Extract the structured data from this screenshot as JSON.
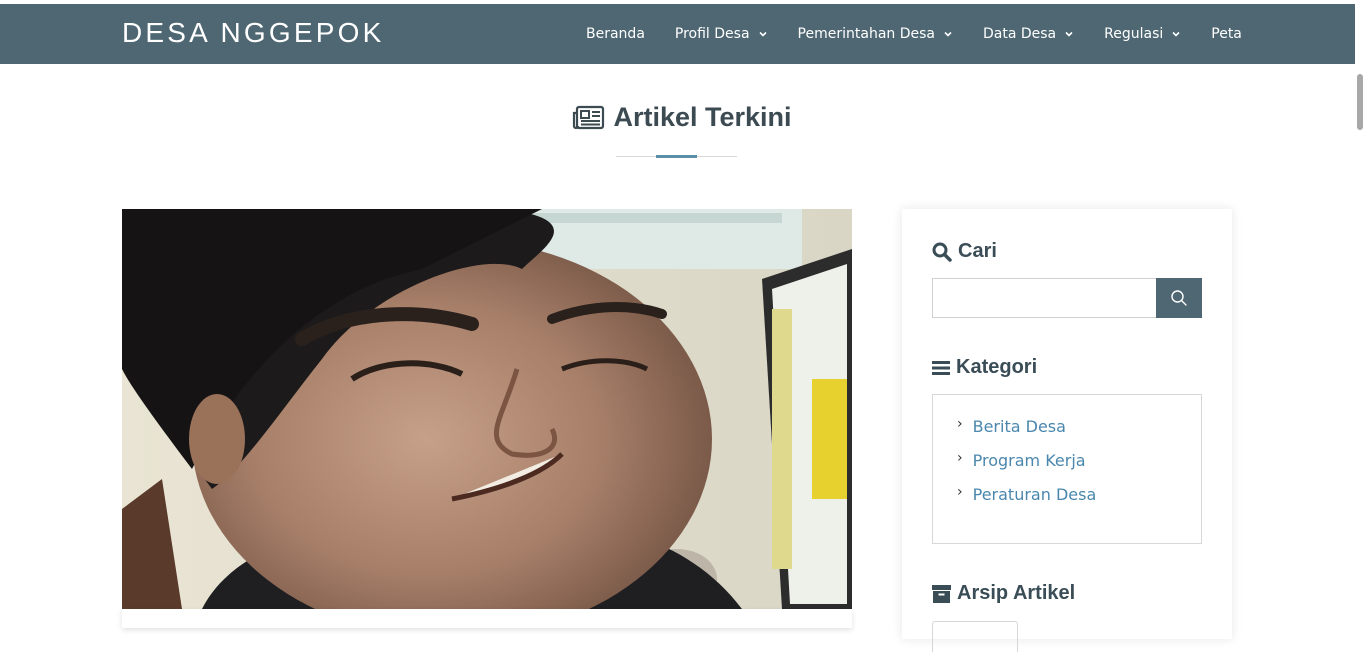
{
  "site": {
    "brand": "DESA NGGEPOK"
  },
  "nav": {
    "items": [
      {
        "label": "Beranda",
        "dropdown": false
      },
      {
        "label": "Profil Desa",
        "dropdown": true
      },
      {
        "label": "Pemerintahan Desa",
        "dropdown": true
      },
      {
        "label": "Data Desa",
        "dropdown": true
      },
      {
        "label": "Regulasi",
        "dropdown": true
      },
      {
        "label": "Peta",
        "dropdown": false
      }
    ]
  },
  "main": {
    "section_title": "Artikel Terkini",
    "section_icon": "newspaper-icon"
  },
  "sidebar": {
    "search": {
      "title": "Cari",
      "icon": "search-icon",
      "value": "",
      "placeholder": ""
    },
    "categories": {
      "title": "Kategori",
      "icon": "list-icon",
      "items": [
        {
          "label": "Berita Desa"
        },
        {
          "label": "Program Kerja"
        },
        {
          "label": "Peraturan Desa"
        }
      ]
    },
    "archive": {
      "title": "Arsip Artikel",
      "icon": "archive-icon"
    }
  },
  "colors": {
    "navbar": "#4e6772",
    "accent": "#5b8fa8",
    "link": "#4a87ad",
    "heading": "#3a4d57"
  }
}
